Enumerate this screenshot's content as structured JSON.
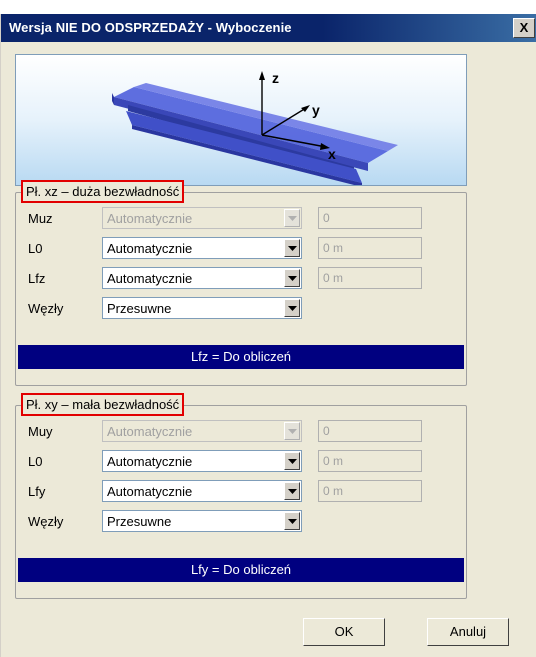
{
  "window": {
    "title": "Wersja NIE DO ODSPRZEDAŻY - Wyboczenie",
    "close_label": "X"
  },
  "diagram": {
    "axis_labels": {
      "z": "z",
      "y": "y",
      "x": "x"
    },
    "beam_color": "#4a5cd6"
  },
  "plane_xz": {
    "legend": "Pł. xz – duża bezwładność",
    "rows": [
      {
        "label": "Muz",
        "select": "Automatycznie",
        "select_disabled": true,
        "field": "0"
      },
      {
        "label": "L0",
        "select": "Automatycznie",
        "select_disabled": false,
        "field": "0 m"
      },
      {
        "label": "Lfz",
        "select": "Automatycznie",
        "select_disabled": false,
        "field": "0 m"
      },
      {
        "label": "Węzły",
        "select": "Przesuwne",
        "select_disabled": false
      }
    ],
    "status": "Lfz = Do obliczeń"
  },
  "plane_xy": {
    "legend": "Pł. xy – mała bezwładność",
    "rows": [
      {
        "label": "Muy",
        "select": "Automatycznie",
        "select_disabled": true,
        "field": "0"
      },
      {
        "label": "L0",
        "select": "Automatycznie",
        "select_disabled": false,
        "field": "0 m"
      },
      {
        "label": "Lfy",
        "select": "Automatycznie",
        "select_disabled": false,
        "field": "0 m"
      },
      {
        "label": "Węzły",
        "select": "Przesuwne",
        "select_disabled": false
      }
    ],
    "status": "Lfy = Do obliczeń"
  },
  "buttons": {
    "ok": "OK",
    "cancel": "Anuluj"
  },
  "colors": {
    "status_bar": "#000080",
    "legend_highlight": "#e20000",
    "title_bar": "#0a246a"
  }
}
